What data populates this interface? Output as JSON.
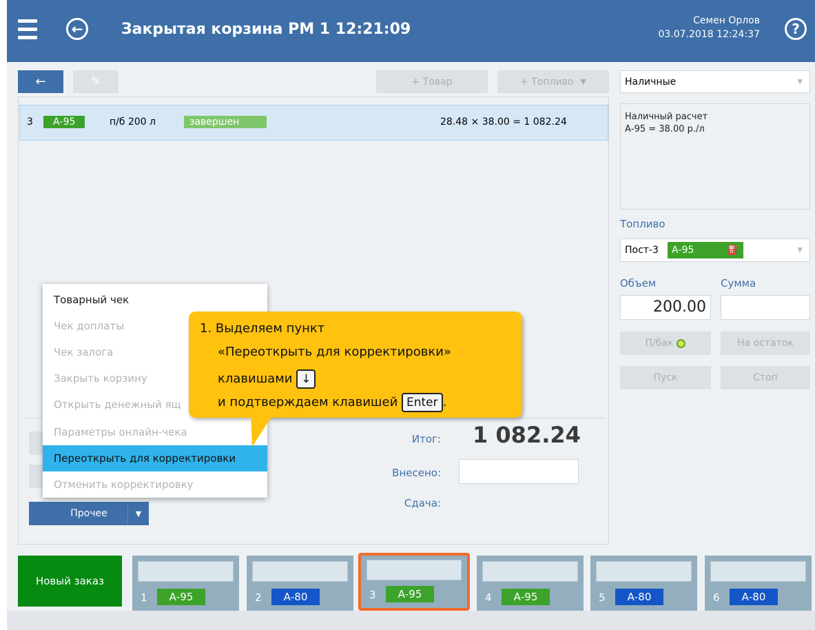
{
  "header": {
    "title": "Закрытая корзина  РМ 1  12:21:09",
    "user_name": "Семен Орлов",
    "datetime": "03.07.2018 12:24:37"
  },
  "toolbar": {
    "back_arrow": "←",
    "edit_icon": "✎",
    "add_product": "+ Товар",
    "add_fuel": "+ Топливо",
    "add_fuel_caret": "▼"
  },
  "order_row": {
    "index": "3",
    "fuel": "А-95",
    "desc": "п/б 200 л",
    "status": "завершен",
    "calc": "28.48 × 38.00 = 1 082.24"
  },
  "context_menu": {
    "items": [
      {
        "label": "Товарный чек",
        "enabled": true
      },
      {
        "label": "Чек доплаты",
        "enabled": false
      },
      {
        "label": "Чек залога",
        "enabled": false
      },
      {
        "label": "Закрыть корзину",
        "enabled": false
      },
      {
        "label": "Открыть денежный ящ",
        "enabled": false
      },
      {
        "label": "Параметры онлайн-чека",
        "enabled": false
      },
      {
        "label": "Переоткрыть для корректировки",
        "enabled": true,
        "selected": true
      },
      {
        "label": "Отменить корректировку",
        "enabled": false
      }
    ]
  },
  "misc_button": {
    "label": "Прочее",
    "caret": "▼"
  },
  "totals": {
    "total_label": "Итог:",
    "total_value": "1 082.24",
    "paid_label": "Внесено:",
    "change_label": "Сдача:"
  },
  "callout": {
    "line1": "1. Выделяем пункт",
    "line2": "«Переоткрыть для корректировки»",
    "line3": "клавишами",
    "key_down": "↓",
    "line4": "и подтверждаем клавишей",
    "key_enter": "Enter",
    "line4_end": "."
  },
  "right_panel": {
    "payment_select": "Наличные",
    "info_line1": "Наличный расчет",
    "info_line2": "А-95 = 38.00 р./л",
    "fuel_label": "Топливо",
    "post": "Пост-3",
    "post_fuel": "А-95",
    "nozzle_icon": "⛽",
    "volume_label": "Объем",
    "sum_label": "Сумма",
    "volume_value": "200.00",
    "fill_btn": "П/бак",
    "remainder_btn": "На остаток",
    "start_btn": "Пуск",
    "stop_btn": "Стоп"
  },
  "bottom": {
    "new_order": "Новый заказ",
    "tabs": [
      {
        "num": "1",
        "fuel": "А-95",
        "color": "green"
      },
      {
        "num": "2",
        "fuel": "А-80",
        "color": "blue"
      },
      {
        "num": "3",
        "fuel": "А-95",
        "color": "green",
        "active": true
      },
      {
        "num": "4",
        "fuel": "А-95",
        "color": "green"
      },
      {
        "num": "5",
        "fuel": "А-80",
        "color": "blue"
      },
      {
        "num": "6",
        "fuel": "А-80",
        "color": "blue"
      }
    ]
  },
  "colors": {
    "header": "#3e6fa8",
    "green": "#3da22a",
    "blue": "#1455c7",
    "menu_selected": "#2fb3ea",
    "callout": "#ffc20e",
    "active_tab_border": "#f26a2e"
  }
}
